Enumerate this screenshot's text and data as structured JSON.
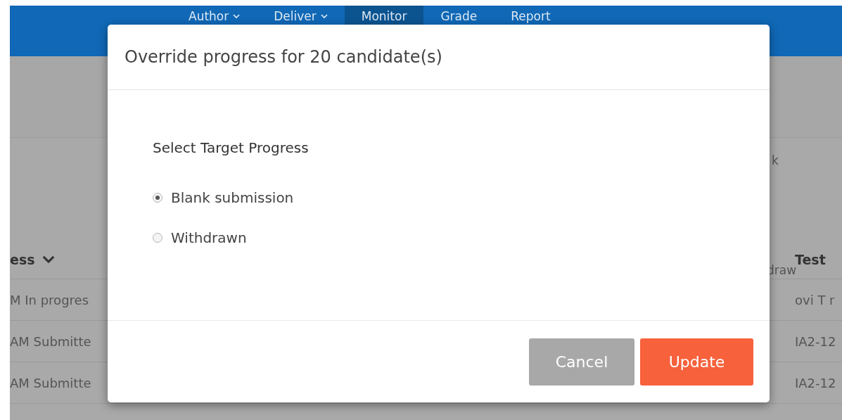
{
  "nav": {
    "items": [
      {
        "label": "Author",
        "dropdown": true,
        "selected": false
      },
      {
        "label": "Deliver",
        "dropdown": true,
        "selected": false
      },
      {
        "label": "Monitor",
        "dropdown": false,
        "selected": true
      },
      {
        "label": "Grade",
        "dropdown": false,
        "selected": false
      },
      {
        "label": "Report",
        "dropdown": false,
        "selected": false
      }
    ]
  },
  "background": {
    "filter_label": "k",
    "filter_option": "draw",
    "table": {
      "columns": [
        {
          "label": "ess",
          "sortable": true
        },
        {
          "label": "Test",
          "sortable": false
        }
      ],
      "rows": [
        [
          "M In progres",
          "ovi T r"
        ],
        [
          "AM Submitte",
          "IA2-12"
        ],
        [
          "AM Submitte",
          "IA2-12"
        ]
      ]
    }
  },
  "dialog": {
    "title": "Override progress for 20 candidate(s)",
    "prompt": "Select Target Progress",
    "options": [
      {
        "label": "Blank submission",
        "selected": true
      },
      {
        "label": "Withdrawn",
        "selected": false
      }
    ],
    "buttons": [
      {
        "label": "Cancel",
        "kind": "secondary"
      },
      {
        "label": "Update",
        "kind": "primary"
      }
    ]
  }
}
